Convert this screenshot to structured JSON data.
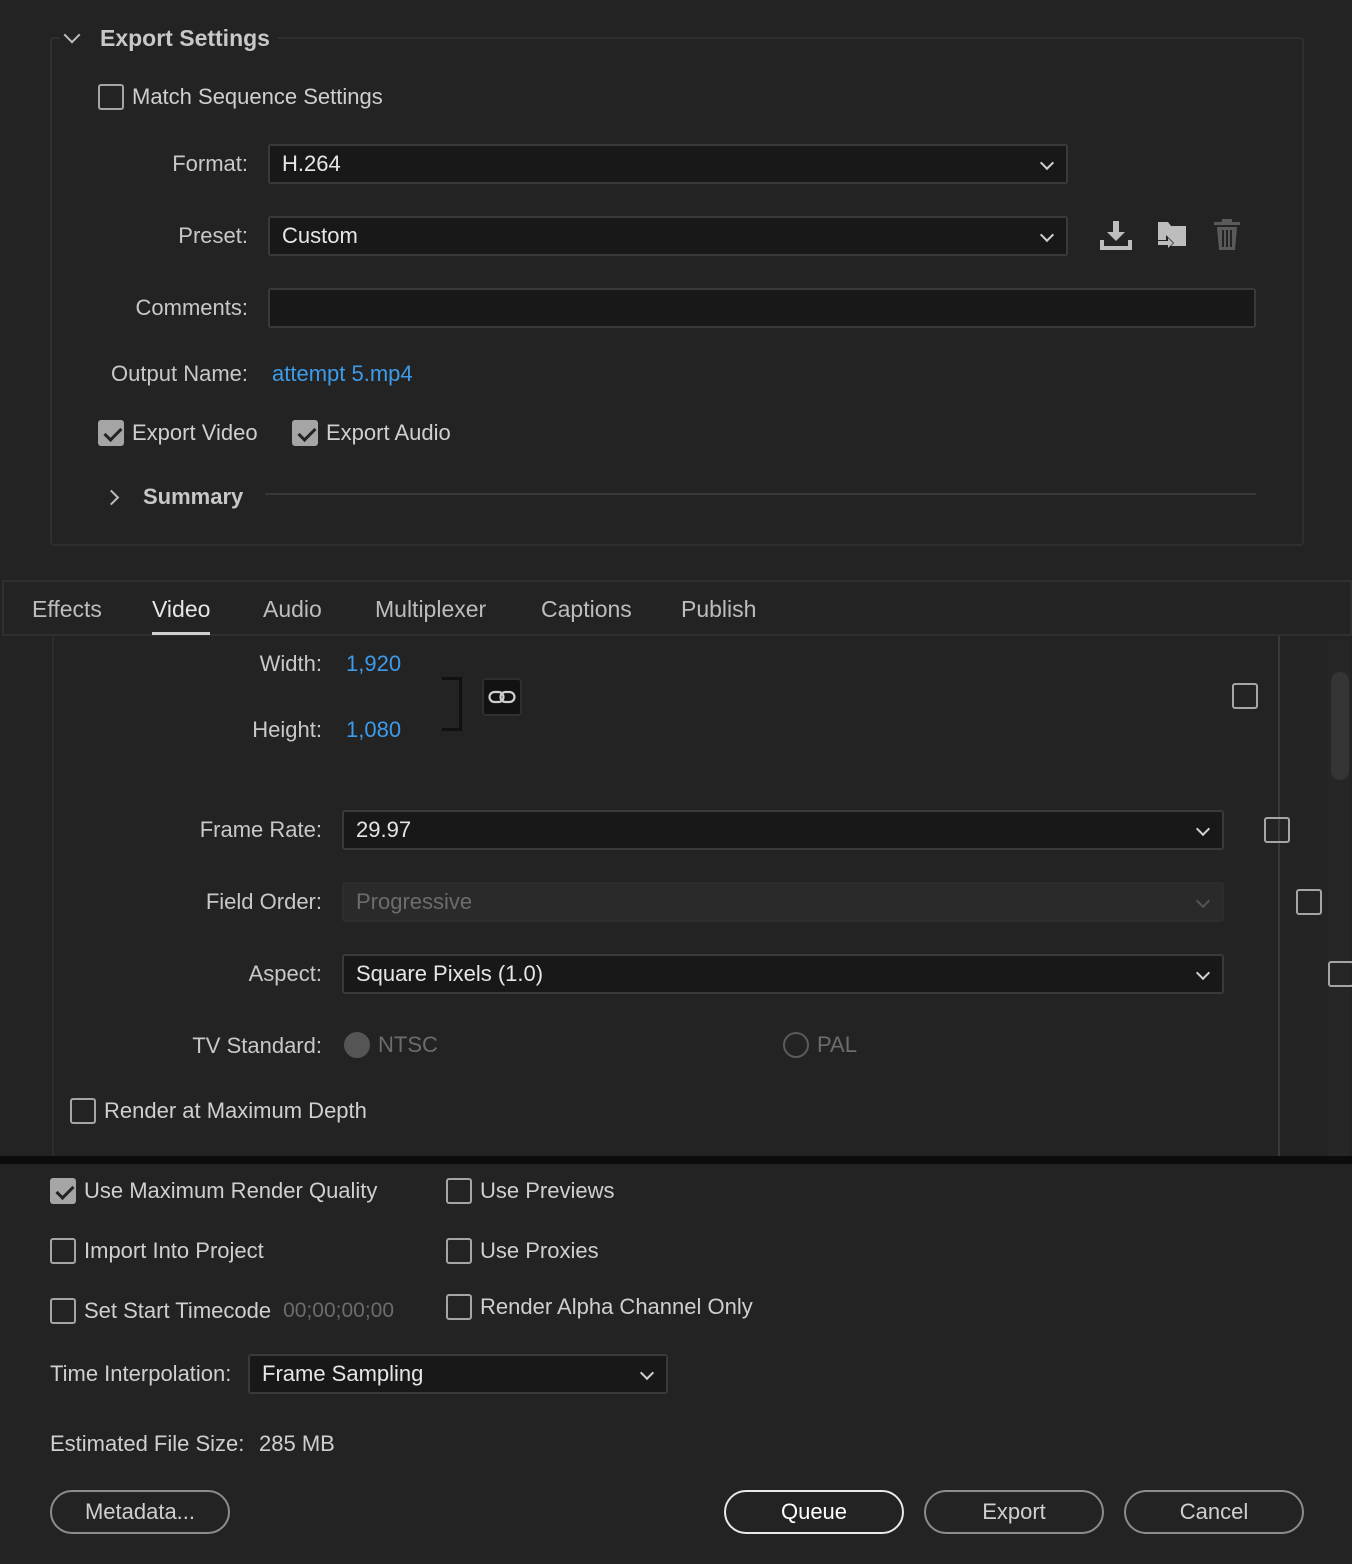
{
  "export_settings": {
    "title": "Export Settings",
    "match_sequence_label": "Match Sequence Settings",
    "match_sequence_checked": false,
    "format_label": "Format:",
    "format_value": "H.264",
    "preset_label": "Preset:",
    "preset_value": "Custom",
    "comments_label": "Comments:",
    "comments_value": "",
    "output_name_label": "Output Name:",
    "output_name_value": "attempt 5.mp4",
    "export_video_label": "Export Video",
    "export_video_checked": true,
    "export_audio_label": "Export Audio",
    "export_audio_checked": true,
    "summary_label": "Summary",
    "preset_icons": [
      "save-preset-icon",
      "import-preset-icon",
      "delete-preset-icon"
    ]
  },
  "tabs": [
    {
      "label": "Effects",
      "active": false
    },
    {
      "label": "Video",
      "active": true
    },
    {
      "label": "Audio",
      "active": false
    },
    {
      "label": "Multiplexer",
      "active": false
    },
    {
      "label": "Captions",
      "active": false
    },
    {
      "label": "Publish",
      "active": false
    }
  ],
  "video": {
    "width_label": "Width:",
    "width_value": "1,920",
    "height_label": "Height:",
    "height_value": "1,080",
    "frame_rate_label": "Frame Rate:",
    "frame_rate_value": "29.97",
    "field_order_label": "Field Order:",
    "field_order_value": "Progressive",
    "aspect_label": "Aspect:",
    "aspect_value": "Square Pixels (1.0)",
    "tv_standard_label": "TV Standard:",
    "tv_ntsc_label": "NTSC",
    "tv_pal_label": "PAL",
    "render_max_depth_label": "Render at Maximum Depth",
    "render_max_depth_checked": false
  },
  "bottom": {
    "use_max_render_quality_label": "Use Maximum Render Quality",
    "use_max_render_quality_checked": true,
    "use_previews_label": "Use Previews",
    "use_previews_checked": false,
    "import_into_project_label": "Import Into Project",
    "import_into_project_checked": false,
    "use_proxies_label": "Use Proxies",
    "use_proxies_checked": false,
    "set_start_timecode_label": "Set Start Timecode",
    "set_start_timecode_checked": false,
    "start_timecode_value": "00;00;00;00",
    "render_alpha_label": "Render Alpha Channel Only",
    "render_alpha_checked": false,
    "time_interpolation_label": "Time Interpolation:",
    "time_interpolation_value": "Frame Sampling",
    "estimated_size_label": "Estimated File Size:",
    "estimated_size_value": "285 MB",
    "metadata_button": "Metadata...",
    "queue_button": "Queue",
    "export_button": "Export",
    "cancel_button": "Cancel"
  },
  "colors": {
    "background": "#232323",
    "accent_link": "#3d9be9",
    "field_bg": "#181818"
  }
}
